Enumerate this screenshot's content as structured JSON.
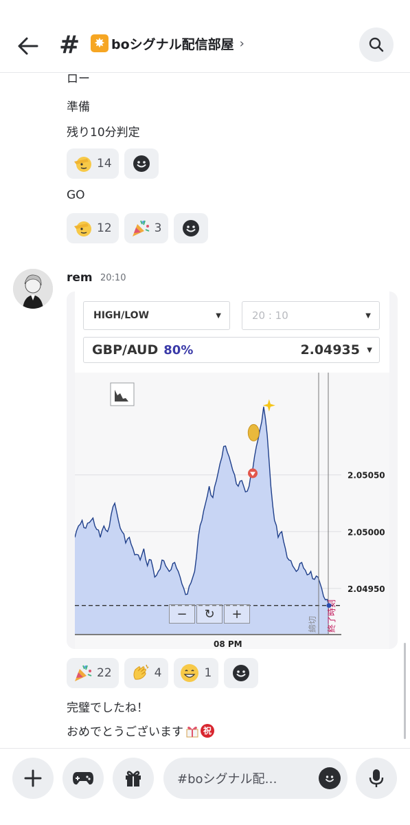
{
  "header": {
    "title": "boシグナル配信部屋",
    "channel_emoji": "✸"
  },
  "messages_top": {
    "line_partial": "ロー",
    "line_junbi": "準備",
    "line_remaining": "残り10分判定",
    "reactions_1": [
      {
        "count": "14"
      }
    ],
    "line_go": "GO",
    "reactions_2": [
      {
        "count": "12"
      },
      {
        "count": "3"
      }
    ]
  },
  "post": {
    "author": "rem",
    "time": "20:10",
    "trade_card": {
      "type_select": "HIGH/LOW",
      "time_select": "20 : 10",
      "asset": "GBP/AUD",
      "payout": "80%",
      "price": "2.04935",
      "close_label": "締切",
      "end_label": "終了時刻",
      "x_label": "08 PM"
    },
    "reactions": [
      {
        "count": "22"
      },
      {
        "count": "4"
      },
      {
        "count": "1"
      }
    ],
    "text_1": "完璧でしたね！",
    "text_2": "おめでとうございます",
    "text_2_badge": "祝"
  },
  "chart_data": {
    "type": "area",
    "title": "",
    "xlabel": "",
    "ylabel": "",
    "x_tick_labels": [
      "08 PM"
    ],
    "y_tick_labels": [
      "2.05050",
      "2.05000",
      "2.04950"
    ],
    "ylim": [
      2.0491,
      2.0514
    ],
    "grid": true,
    "entry_level": 2.04935,
    "series": [
      {
        "values": [
          2.04995,
          2.05005,
          2.0501,
          2.05003,
          2.05008,
          2.05012,
          2.05002,
          2.04995,
          2.05005,
          2.05,
          2.05015,
          2.05025,
          2.0501,
          2.05,
          2.0499,
          2.04995,
          2.04985,
          2.0498,
          2.04975,
          2.04985,
          2.0497,
          2.04975,
          2.0496,
          2.04965,
          2.04975,
          2.0497,
          2.04965,
          2.04972,
          2.04968,
          2.0496,
          2.0495,
          2.04945,
          2.04955,
          2.04965,
          2.04995,
          2.0501,
          2.05025,
          2.0504,
          2.0503,
          2.05045,
          2.0506,
          2.05075,
          2.0507,
          2.0506,
          2.0505,
          2.0504,
          2.05045,
          2.05035,
          2.0504,
          2.05055,
          2.05075,
          2.0509,
          2.0511,
          2.05085,
          2.0504,
          2.0501,
          2.04995,
          2.05,
          2.04985,
          2.04975,
          2.0497,
          2.04965,
          2.04972,
          2.04968,
          2.04962,
          2.04965,
          2.04958,
          2.0496,
          2.0495,
          2.0494,
          2.04935
        ]
      }
    ],
    "markers": [
      {
        "kind": "coin",
        "x_index": 50
      },
      {
        "kind": "down-arrow",
        "x_index": 49
      },
      {
        "kind": "sparkle",
        "x_index": 52
      }
    ]
  },
  "composer": {
    "placeholder": "#boシグナル配…"
  },
  "colors": {
    "accent": "#5865f2",
    "chart_line": "#1f3f8a",
    "chart_fill": "#c8d5f4",
    "payout": "#3a3aa8",
    "end_label": "#c2185b"
  }
}
